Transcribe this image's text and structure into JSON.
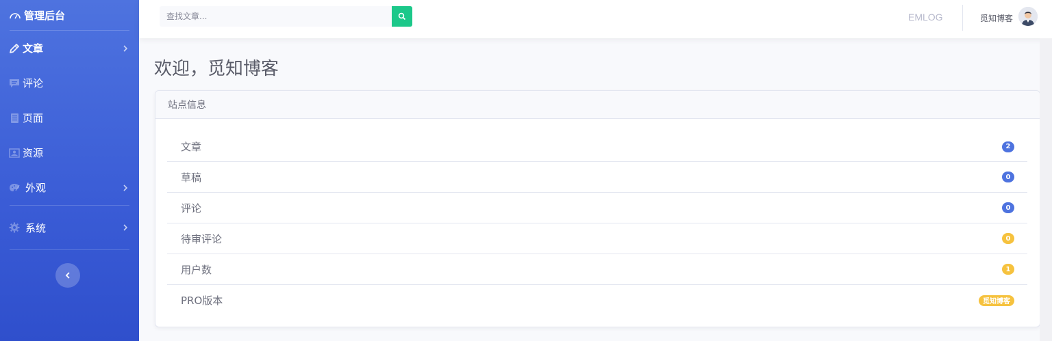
{
  "sidebar": {
    "brand": "管理后台",
    "items": [
      {
        "label": "文章",
        "icon": "pencil-icon",
        "has_arrow": true
      },
      {
        "label": "评论",
        "icon": "comment-icon",
        "has_arrow": false
      },
      {
        "label": "页面",
        "icon": "document-icon",
        "has_arrow": false
      },
      {
        "label": "资源",
        "icon": "image-icon",
        "has_arrow": false
      },
      {
        "label": "外观",
        "icon": "palette-icon",
        "has_arrow": true
      },
      {
        "label": "系统",
        "icon": "gear-icon",
        "has_arrow": true
      }
    ],
    "collapse_icon": "chevron-left-icon"
  },
  "topbar": {
    "search_placeholder": "查找文章...",
    "search_icon": "search-icon",
    "link": "EMLOG",
    "user_name": "觅知博客",
    "avatar_icon": "user-avatar-icon"
  },
  "main": {
    "title": "欢迎，觅知博客",
    "card": {
      "header": "站点信息",
      "rows": [
        {
          "label": "文章",
          "value": "2",
          "color": "#4e73df"
        },
        {
          "label": "草稿",
          "value": "0",
          "color": "#4e73df"
        },
        {
          "label": "评论",
          "value": "0",
          "color": "#4e73df"
        },
        {
          "label": "待审评论",
          "value": "0",
          "color": "#f6c23e"
        },
        {
          "label": "用户数",
          "value": "1",
          "color": "#f6c23e"
        },
        {
          "label": "PRO版本",
          "value": "觅知博客",
          "color": "#f6c23e"
        }
      ]
    }
  },
  "colors": {
    "sidebar_top": "#4e73df",
    "sidebar_bottom": "#2f4fcc",
    "search_button": "#1cc88a",
    "primary_badge": "#4e73df",
    "warning_badge": "#f6c23e"
  }
}
